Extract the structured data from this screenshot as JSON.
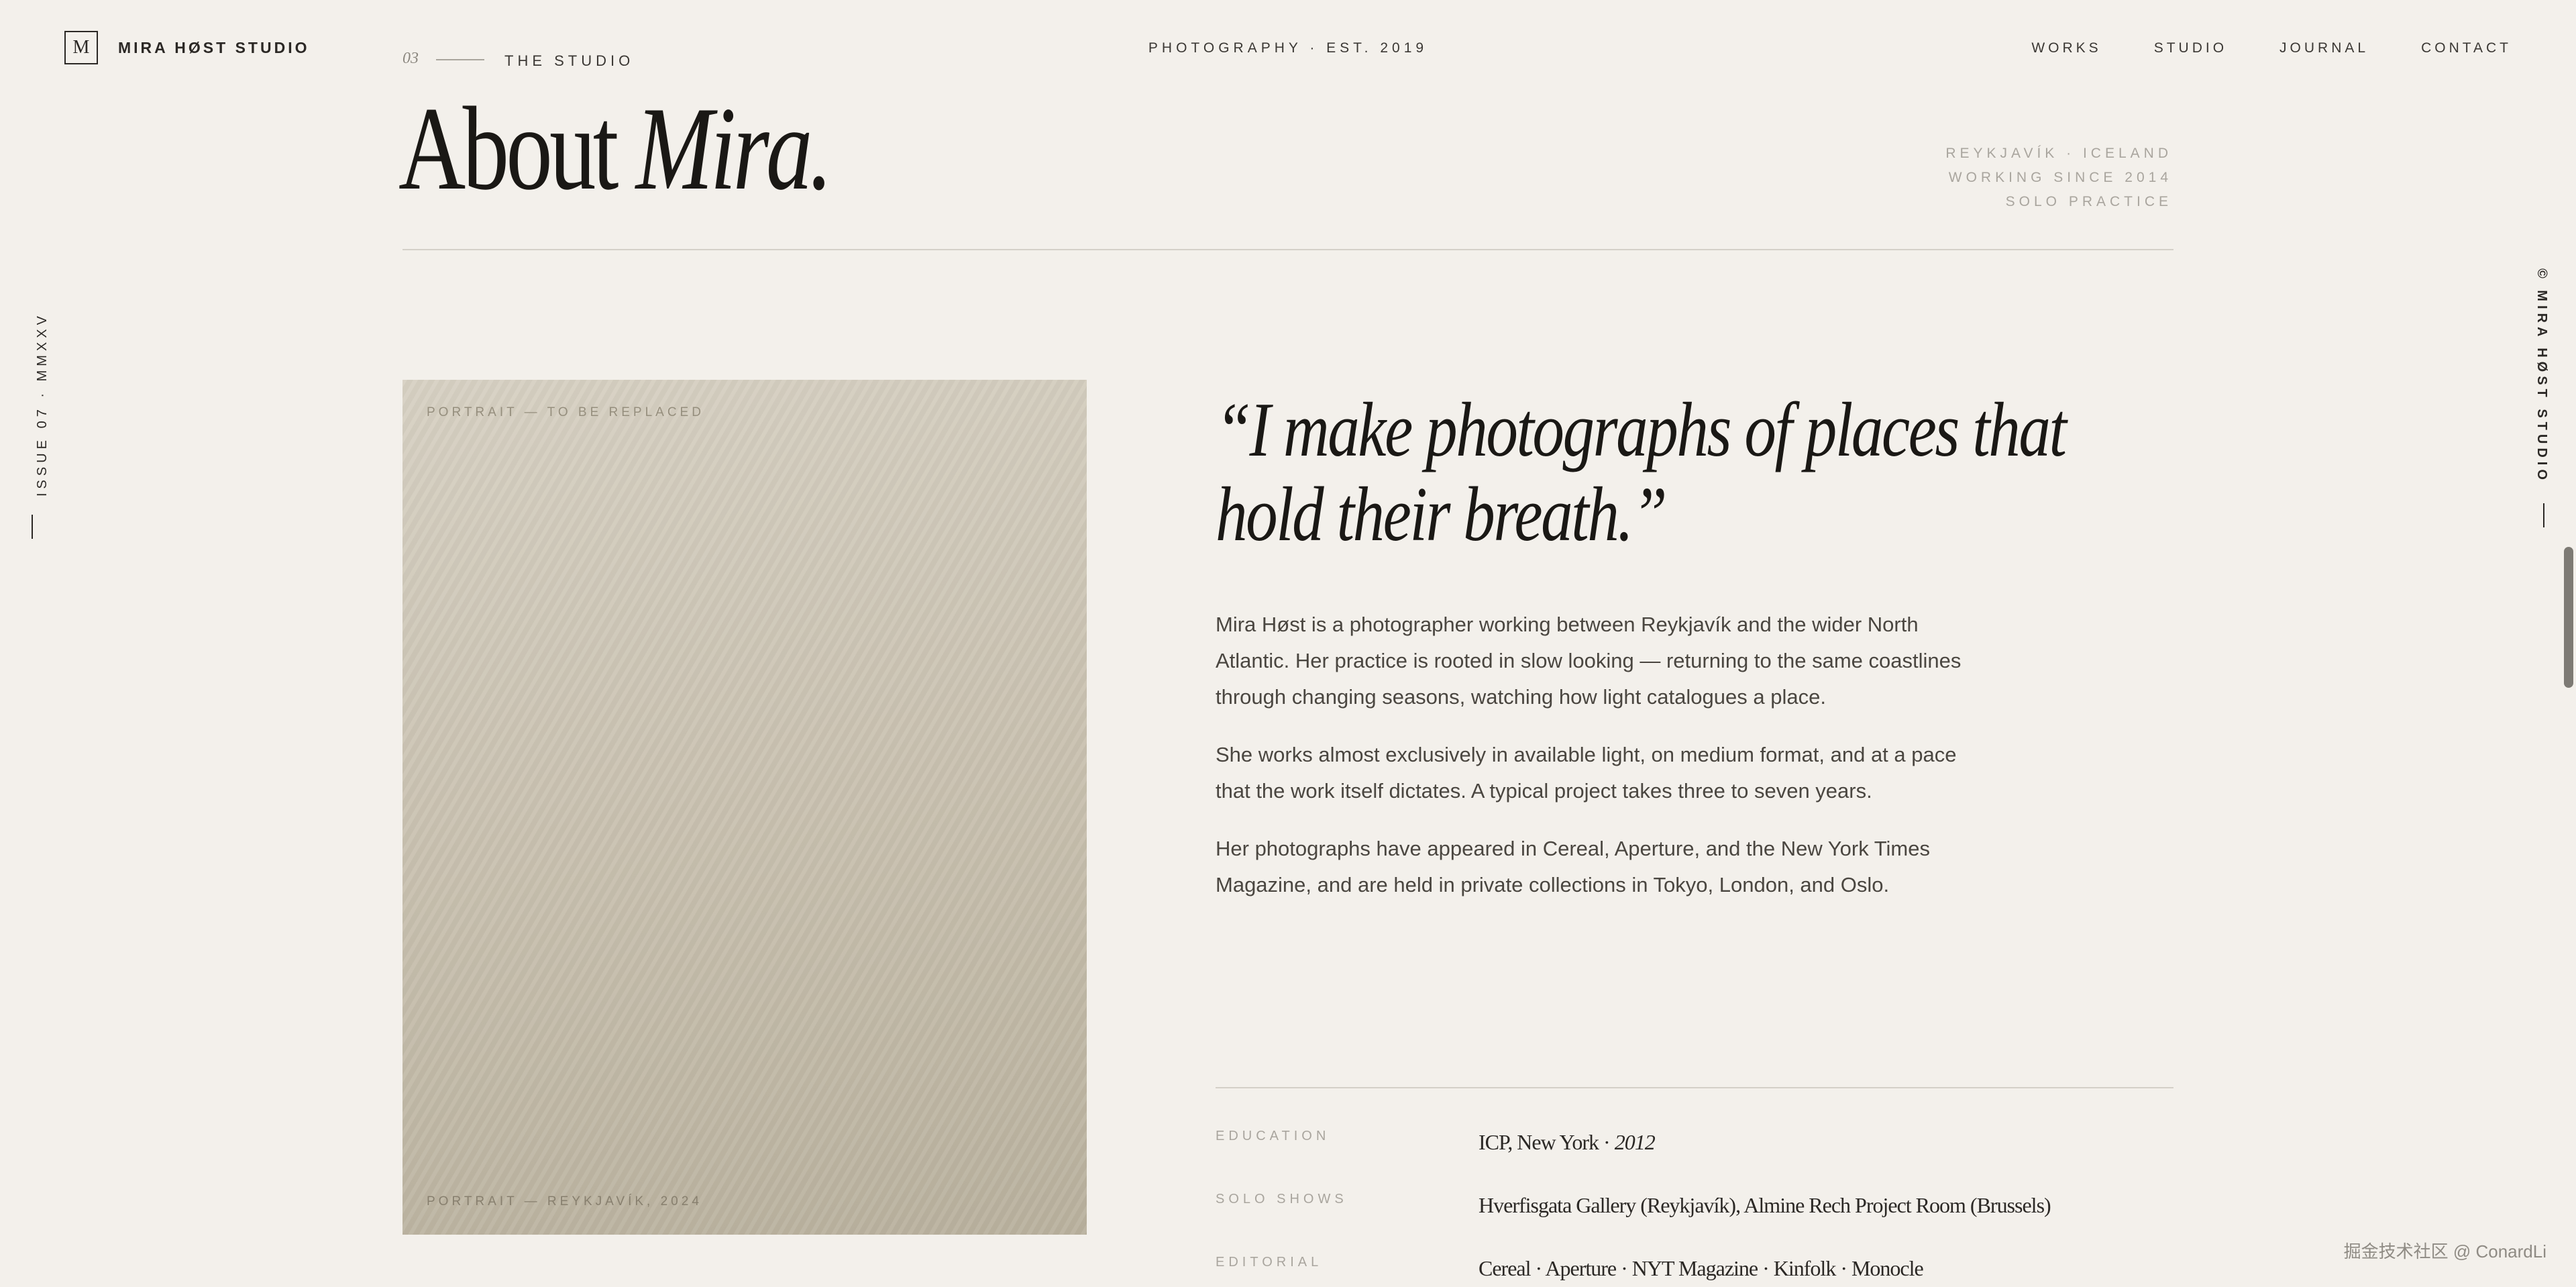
{
  "header": {
    "logo_letter": "M",
    "brand": "MIRA HØST STUDIO",
    "crumb_number": "03",
    "crumb_label": "THE STUDIO",
    "tagline": "PHOTOGRAPHY · EST. 2019",
    "nav": [
      {
        "label": "WORKS"
      },
      {
        "label": "STUDIO"
      },
      {
        "label": "JOURNAL"
      },
      {
        "label": "CONTACT"
      }
    ]
  },
  "hero": {
    "title_plain": "About ",
    "title_italic": "Mira.",
    "meta": [
      "REYKJAVÍK · ICELAND",
      "WORKING SINCE 2014",
      "SOLO PRACTICE"
    ]
  },
  "side": {
    "left_text": "ISSUE 07 · MMXXV",
    "right_text": "© MIRA HØST STUDIO"
  },
  "portrait": {
    "caption_top": "PORTRAIT — TO BE REPLACED",
    "caption_bottom": "PORTRAIT — REYKJAVÍK, 2024"
  },
  "quote": {
    "line1": "“I make photographs of places that",
    "line2": "hold their breath.”"
  },
  "bio": {
    "paragraphs": [
      "Mira Høst is a photographer working between Reykjavík and the wider North Atlantic. Her practice is rooted in slow looking — returning to the same coastlines through changing seasons, watching how light catalogues a place.",
      "She works almost exclusively in available light, on medium format, and at a pace that the work itself dictates. A typical project takes three to seven years.",
      "Her photographs have appeared in Cereal, Aperture, and the New York Times Magazine, and are held in private collections in Tokyo, London, and Oslo."
    ]
  },
  "details": [
    {
      "label": "EDUCATION",
      "value": "ICP, New York · ",
      "value_italic": "2012"
    },
    {
      "label": "SOLO SHOWS",
      "value": "Hverfisgata Gallery (Reykjavík), Almine Rech Project Room (Brussels)",
      "value_italic": ""
    },
    {
      "label": "EDITORIAL",
      "value": "Cereal · Aperture · NYT Magazine · Kinfolk · Monocle",
      "value_italic": ""
    }
  ],
  "watermark": "掘金技术社区 @ ConardLi"
}
